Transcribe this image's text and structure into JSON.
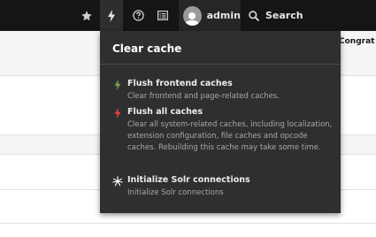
{
  "toolbar": {
    "user": {
      "name": "admin"
    },
    "search": {
      "label": "Search"
    }
  },
  "background": {
    "snippet": "Congrat"
  },
  "clear_cache_menu": {
    "title": "Clear cache",
    "items": [
      {
        "label": "Flush frontend caches",
        "description": "Clear frontend and page-related caches.",
        "icon": "bolt-green-icon",
        "icon_color": "#79a548"
      },
      {
        "label": "Flush all caches",
        "description": "Clear all system-related caches, including localization, extension configuration, file caches and opcode caches. Rebuilding this cache may take some time.",
        "icon": "bolt-red-icon",
        "icon_color": "#e8413c"
      },
      {
        "label": "Initialize Solr connections",
        "description": "Initialize Solr connections",
        "icon": "solr-icon",
        "icon_color": "#ffffff"
      }
    ]
  }
}
